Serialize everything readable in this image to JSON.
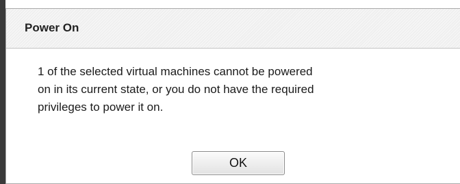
{
  "dialog": {
    "title": "Power On",
    "message_lines": [
      "1 of the selected virtual machines cannot be powered",
      "on in its current state, or you do not have the required",
      "privileges to power it on."
    ],
    "ok_label": "OK"
  }
}
